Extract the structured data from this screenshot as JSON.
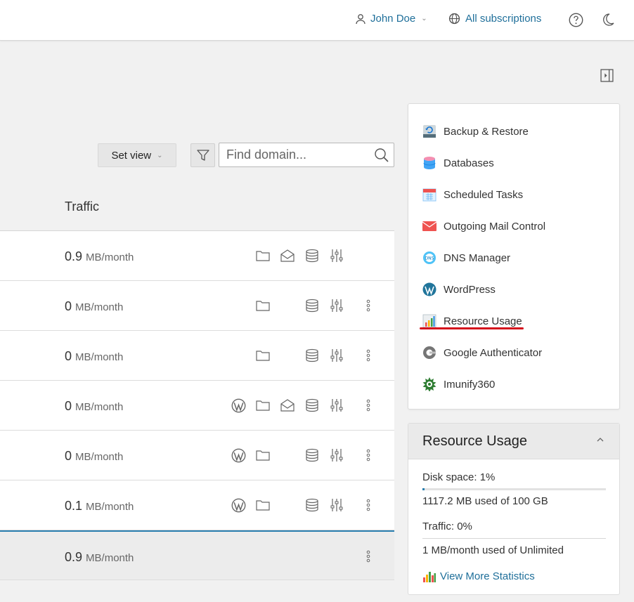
{
  "header": {
    "user_name": "John Doe",
    "subscriptions_label": "All subscriptions",
    "help_icon": "help-icon",
    "theme_icon": "moon-icon"
  },
  "toolbar": {
    "set_view_label": "Set view",
    "search_placeholder": "Find domain..."
  },
  "table": {
    "column_traffic": "Traffic",
    "rows": [
      {
        "traffic_value": "0.9",
        "traffic_unit": "MB/month"
      },
      {
        "traffic_value": "0",
        "traffic_unit": "MB/month"
      },
      {
        "traffic_value": "0",
        "traffic_unit": "MB/month"
      },
      {
        "traffic_value": "0",
        "traffic_unit": "MB/month"
      },
      {
        "traffic_value": "0",
        "traffic_unit": "MB/month"
      },
      {
        "traffic_value": "0.1",
        "traffic_unit": "MB/month"
      },
      {
        "traffic_value": "0.9",
        "traffic_unit": "MB/month"
      }
    ]
  },
  "sidebar": {
    "items": [
      {
        "label": "Backup & Restore",
        "icon": "backup-icon"
      },
      {
        "label": "Databases",
        "icon": "database-icon"
      },
      {
        "label": "Scheduled Tasks",
        "icon": "calendar-icon"
      },
      {
        "label": "Outgoing Mail Control",
        "icon": "mail-icon"
      },
      {
        "label": "DNS Manager",
        "icon": "dns-icon"
      },
      {
        "label": "WordPress",
        "icon": "wordpress-icon"
      },
      {
        "label": "Resource Usage",
        "icon": "chart-icon"
      },
      {
        "label": "Google Authenticator",
        "icon": "authenticator-icon"
      },
      {
        "label": "Imunify360",
        "icon": "imunify-icon"
      }
    ]
  },
  "resource_usage": {
    "title": "Resource Usage",
    "disk_label": "Disk space:",
    "disk_percent": "1%",
    "disk_fraction": 0.01,
    "disk_detail": "1117.2 MB used of 100 GB",
    "traffic_label": "Traffic:",
    "traffic_percent": "0%",
    "traffic_detail": "1 MB/month used of Unlimited",
    "more_link": "View More Statistics"
  },
  "colors": {
    "link": "#1f6f9a",
    "accent": "#2a7fb0",
    "highlight": "#d4101c"
  }
}
